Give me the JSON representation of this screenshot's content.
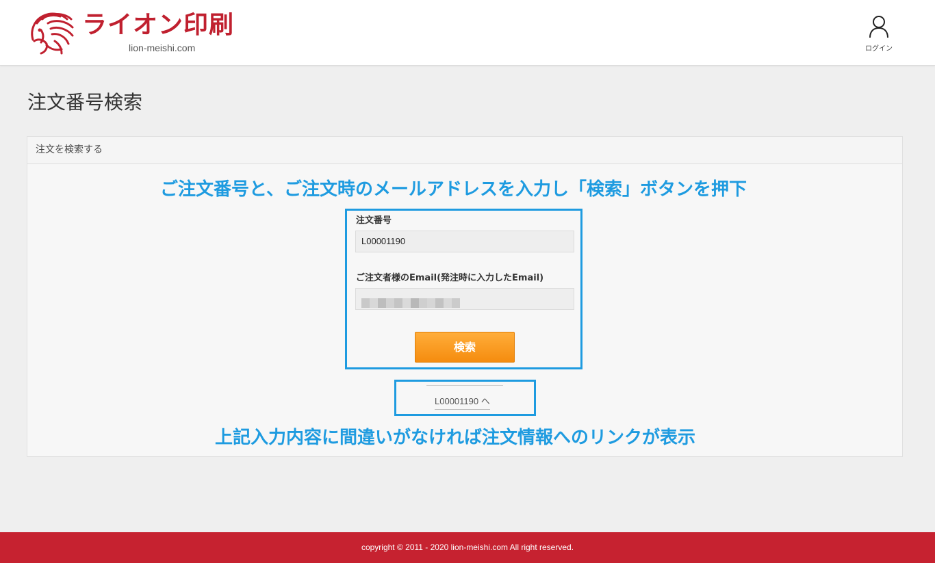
{
  "header": {
    "logo_name": "ライオン印刷",
    "logo_domain": "lion-meishi.com",
    "login_label": "ログイン",
    "brand_color": "#c0202f",
    "icons": {
      "logo": "lion-head-icon",
      "login": "user-icon"
    }
  },
  "page": {
    "title": "注文番号検索"
  },
  "panel": {
    "heading": "注文を検索する"
  },
  "form": {
    "order_number_label": "注文番号",
    "order_number_value": "L00001190",
    "email_label": "ご注文者様のEmail(発注時に入力したEmail)",
    "email_value_masked": true,
    "search_button_label": "検索",
    "search_button_color": "#f7931e"
  },
  "result": {
    "link_text": "L00001190 へ"
  },
  "annotations": {
    "top": "ご注文番号と、ご注文時のメールアドレスを入力し「検索」ボタンを押下",
    "bottom": "上記入力内容に間違いがなければ注文情報へのリンクが表示",
    "color": "#1e9be0"
  },
  "footer": {
    "copyright": "copyright © 2011 - 2020 lion-meishi.com All right reserved.",
    "color": "#c62230"
  }
}
